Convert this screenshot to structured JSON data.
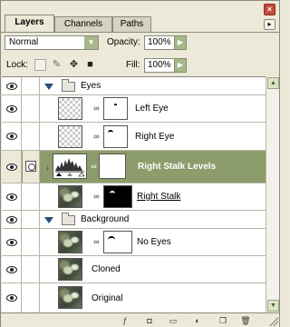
{
  "tabs": [
    {
      "label": "Layers"
    },
    {
      "label": "Channels"
    },
    {
      "label": "Paths"
    }
  ],
  "blend": {
    "mode": "Normal",
    "opacity_label": "Opacity:",
    "opacity_value": "100%"
  },
  "lock": {
    "label": "Lock:",
    "fill_label": "Fill:",
    "fill_value": "100%"
  },
  "layers": [
    {
      "type": "group",
      "name": "Eyes",
      "visible": true,
      "expanded": true
    },
    {
      "type": "layer",
      "name": "Left Eye",
      "visible": true
    },
    {
      "type": "layer",
      "name": "Right Eye",
      "visible": true
    },
    {
      "type": "adjustment",
      "name": "Right Stalk Levels",
      "visible": true,
      "selected": true
    },
    {
      "type": "layer",
      "name": "Right Stalk",
      "visible": true
    },
    {
      "type": "group",
      "name": "Background",
      "visible": true,
      "expanded": true
    },
    {
      "type": "layer",
      "name": "No Eyes",
      "visible": true
    },
    {
      "type": "layer",
      "name": "Cloned",
      "visible": true
    },
    {
      "type": "layer",
      "name": "Original",
      "visible": true
    }
  ],
  "colors": {
    "panel_bg": "#ece9d8",
    "selected_bg": "#8c9c6a",
    "accent_green": "#a7b88c",
    "close_red": "#c64b3c"
  }
}
